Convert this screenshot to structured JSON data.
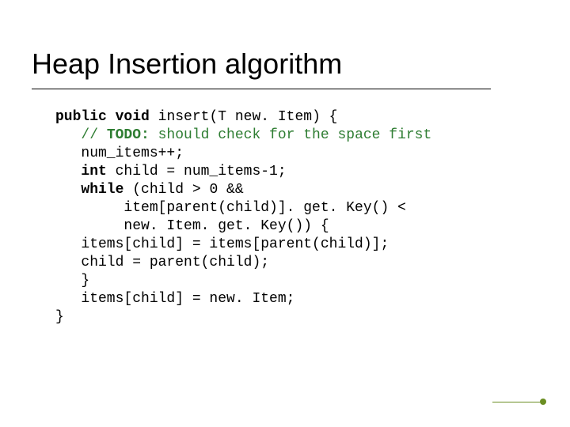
{
  "slide": {
    "title": "Heap Insertion algorithm"
  },
  "code": {
    "l01_kw1": "public",
    "l01_kw2": "void",
    "l01_rest": " insert(T new. Item) {",
    "l02_pre": "   ",
    "l02_comment_slashes": "// ",
    "l02_comment_bold": "TODO:",
    "l02_comment_rest": " should check for the space first",
    "l03": "   num_items++;",
    "l04_pre": "   ",
    "l04_kw": "int",
    "l04_rest": " child = num_items-1;",
    "l05_pre": "   ",
    "l05_kw": "while",
    "l05_rest": " (child > 0 &&",
    "l06": "        item[parent(child)]. get. Key() <",
    "l07": "        new. Item. get. Key()) {",
    "l08": "   items[child] = items[parent(child)];",
    "l09": "   child = parent(child);",
    "l10": "   }",
    "l11": "   items[child] = new. Item;",
    "l12": "}"
  }
}
